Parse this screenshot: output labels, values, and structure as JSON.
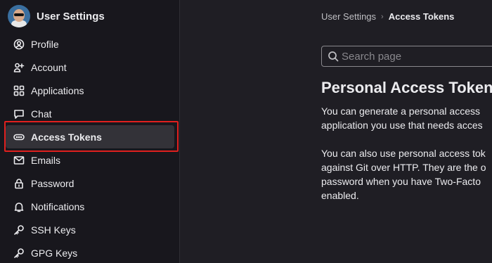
{
  "sidebar": {
    "title": "User Settings",
    "items": [
      {
        "label": "Profile",
        "icon": "profile-icon"
      },
      {
        "label": "Account",
        "icon": "account-icon"
      },
      {
        "label": "Applications",
        "icon": "applications-icon"
      },
      {
        "label": "Chat",
        "icon": "chat-icon"
      },
      {
        "label": "Access Tokens",
        "icon": "token-icon",
        "active": true
      },
      {
        "label": "Emails",
        "icon": "mail-icon"
      },
      {
        "label": "Password",
        "icon": "lock-icon"
      },
      {
        "label": "Notifications",
        "icon": "bell-icon"
      },
      {
        "label": "SSH Keys",
        "icon": "key-icon"
      },
      {
        "label": "GPG Keys",
        "icon": "key-icon"
      }
    ]
  },
  "breadcrumb": {
    "parent": "User Settings",
    "separator": "›",
    "current": "Access Tokens"
  },
  "search": {
    "placeholder": "Search page"
  },
  "main": {
    "title": "Personal Access Tokens",
    "paragraph1": [
      "You can generate a personal access",
      "application you use that needs acces"
    ],
    "paragraph2": [
      "You can also use personal access tok",
      "against Git over HTTP. They are the o",
      "password when you have Two-Facto",
      "enabled."
    ]
  },
  "colors": {
    "sidebar_bg": "#18171d",
    "main_bg": "#1f1e24",
    "active_item_bg": "#333238",
    "highlight_border": "#e0201e"
  }
}
